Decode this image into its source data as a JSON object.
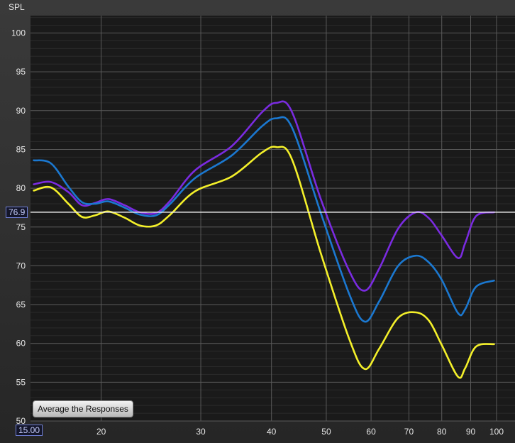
{
  "chart_data": {
    "type": "line",
    "ylabel": "SPL",
    "xscale": "log",
    "xlim": [
      15,
      100
    ],
    "ylim": [
      50,
      102
    ],
    "xticks": [
      20,
      30,
      40,
      50,
      60,
      70,
      80,
      90,
      100
    ],
    "yticks": [
      50,
      55,
      60,
      65,
      70,
      75,
      80,
      85,
      90,
      95,
      100
    ],
    "grid": true,
    "reference_line": 76.9,
    "series": [
      {
        "color": "#7a2be0",
        "x": [
          15.2,
          16.3,
          17.5,
          18.5,
          19.5,
          20.6,
          22,
          23.4,
          25,
          26.5,
          29.3,
          34,
          38.5,
          40.8,
          43.5,
          49,
          55,
          58.5,
          62,
          67,
          72,
          76,
          80,
          85.5,
          88,
          92,
          99
        ],
        "y": [
          80.5,
          80.8,
          79.5,
          77.8,
          78.1,
          78.6,
          77.8,
          76.9,
          76.8,
          78.4,
          82.3,
          85.4,
          89.8,
          91.0,
          89.8,
          78.4,
          69.2,
          66.8,
          69.6,
          74.8,
          76.9,
          76.1,
          73.9,
          71.0,
          72.9,
          76.4,
          76.9
        ]
      },
      {
        "color": "#1b78d0",
        "x": [
          15.2,
          16.3,
          17.5,
          18.5,
          19.5,
          20.6,
          22,
          23.4,
          25,
          26.5,
          29.3,
          34,
          38.5,
          40.8,
          43.5,
          49,
          55,
          58.5,
          62,
          67,
          72,
          76,
          80,
          85.5,
          88,
          92,
          99
        ],
        "y": [
          83.6,
          83.2,
          80.2,
          78.2,
          78.0,
          78.3,
          77.5,
          76.6,
          76.5,
          78.0,
          81.3,
          84.2,
          88.0,
          89.0,
          87.8,
          76.6,
          66.2,
          62.8,
          65.4,
          70.0,
          71.3,
          70.4,
          68.2,
          63.9,
          64.4,
          67.3,
          68.1
        ]
      },
      {
        "color": "#f4f02a",
        "x": [
          15.2,
          16.3,
          17.5,
          18.5,
          19.5,
          20.6,
          22,
          23.4,
          25,
          26.5,
          29.3,
          34,
          38.5,
          40.8,
          43.5,
          49,
          55,
          58.5,
          62,
          67,
          72,
          76,
          80,
          85.5,
          88,
          92,
          99
        ],
        "y": [
          79.7,
          80.1,
          78.0,
          76.3,
          76.5,
          77.0,
          76.2,
          75.2,
          75.2,
          76.6,
          79.6,
          81.5,
          84.6,
          85.3,
          83.7,
          71.4,
          60.4,
          56.7,
          59.3,
          63.3,
          64.0,
          62.9,
          59.8,
          55.7,
          56.8,
          59.6,
          59.9
        ]
      }
    ]
  },
  "readouts": {
    "y": "76.9",
    "x": "15.00"
  },
  "button": {
    "average_label": "Average the Responses"
  }
}
